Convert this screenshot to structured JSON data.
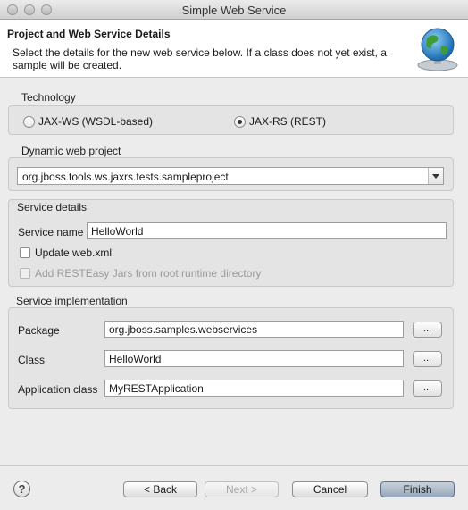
{
  "window": {
    "title": "Simple Web Service"
  },
  "header": {
    "title": "Project and Web Service Details",
    "description": "Select the details for the new web service below. If a class does not yet exist, a sample will be created."
  },
  "technology": {
    "label": "Technology",
    "options": [
      {
        "label": "JAX-WS (WSDL-based)",
        "selected": false
      },
      {
        "label": "JAX-RS (REST)",
        "selected": true
      }
    ]
  },
  "project": {
    "label": "Dynamic web project",
    "value": "org.jboss.tools.ws.jaxrs.tests.sampleproject"
  },
  "service_details": {
    "label": "Service details",
    "service_name_label": "Service name",
    "service_name_value": "HelloWorld",
    "update_webxml_label": "Update web.xml",
    "update_webxml_checked": false,
    "resteasy_label": "Add RESTEasy Jars from root runtime directory",
    "resteasy_checked": false,
    "resteasy_enabled": false
  },
  "implementation": {
    "label": "Service implementation",
    "package_label": "Package",
    "package_value": "org.jboss.samples.webservices",
    "class_label": "Class",
    "class_value": "HelloWorld",
    "app_class_label": "Application class",
    "app_class_value": "MyRESTApplication",
    "browse_label": "..."
  },
  "footer": {
    "back_label": "< Back",
    "next_label": "Next >",
    "cancel_label": "Cancel",
    "finish_label": "Finish",
    "help_symbol": "?"
  }
}
